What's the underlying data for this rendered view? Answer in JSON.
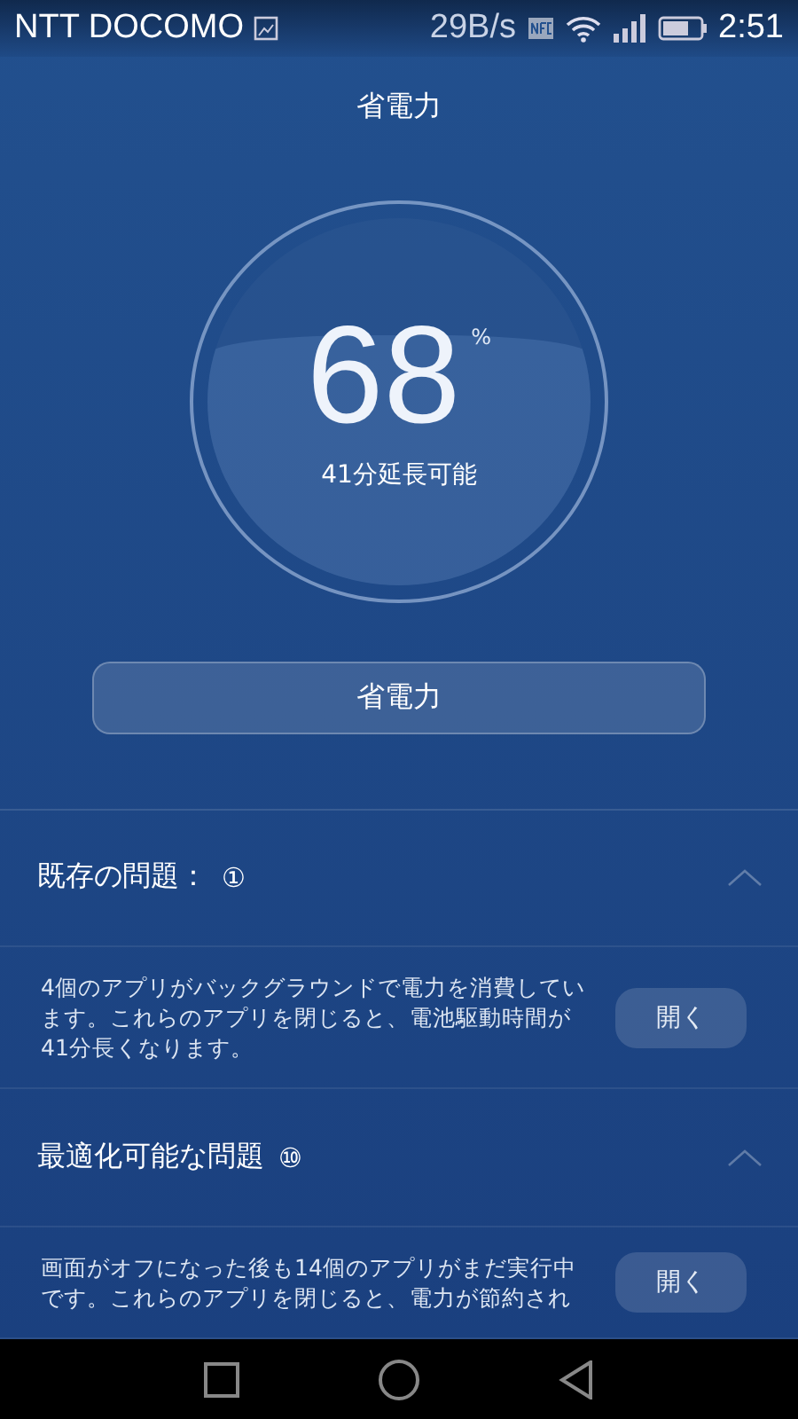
{
  "status_bar": {
    "carrier": "NTT DOCOMO",
    "speed": "29B/s",
    "time": "2:51"
  },
  "title": "省電力",
  "battery": {
    "percent": "68",
    "unit": "%",
    "extension": "41分延長可能"
  },
  "save_button": "省電力",
  "sections": [
    {
      "title": "既存の問題：",
      "count": "①",
      "expanded": true,
      "items": [
        {
          "text": "4個のアプリがバックグラウンドで電力を消費しています。これらのアプリを閉じると、電池駆動時間が41分長くなります。",
          "action": "開く"
        }
      ]
    },
    {
      "title": "最適化可能な問題",
      "count": "⑩",
      "expanded": true,
      "items": [
        {
          "text": "画面がオフになった後も14個のアプリがまだ実行中です。これらのアプリを閉じると、電力が節約され",
          "action": "開く"
        }
      ]
    }
  ]
}
